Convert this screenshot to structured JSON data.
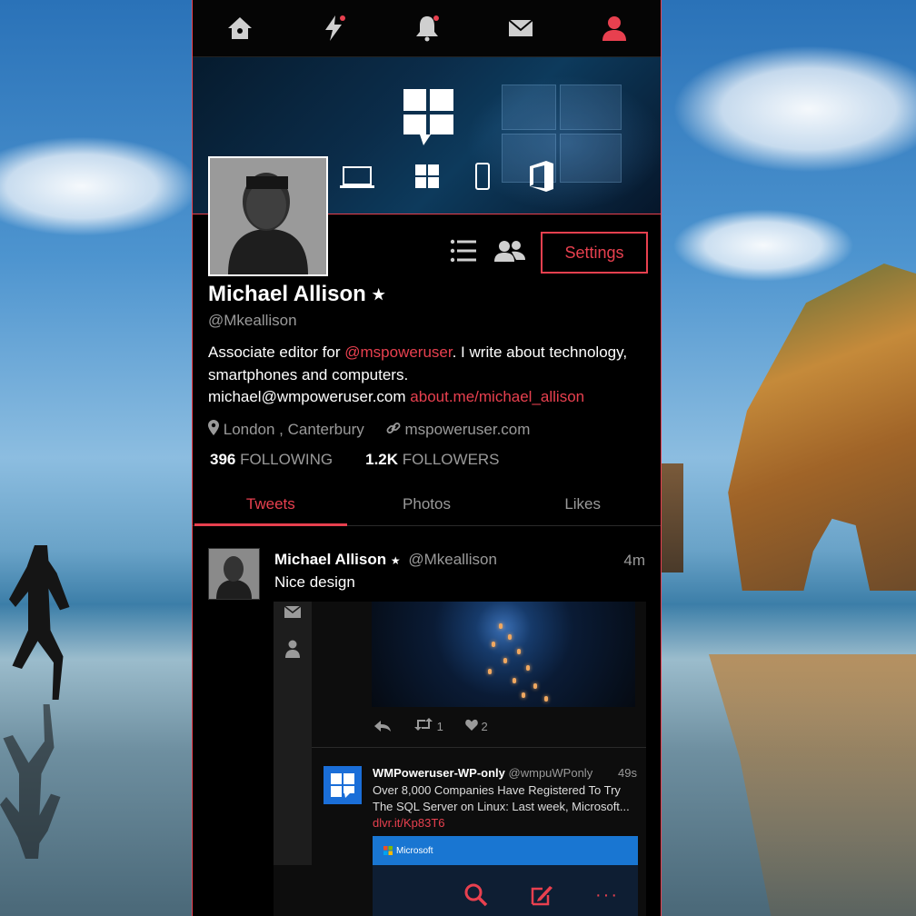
{
  "desktop": {
    "wallpaper": "beach-wallpaper"
  },
  "nav": {
    "items": [
      {
        "icon": "home-icon"
      },
      {
        "icon": "lightning-icon",
        "badge": true
      },
      {
        "icon": "bell-icon",
        "badge": true
      },
      {
        "icon": "mail-icon"
      },
      {
        "icon": "person-icon",
        "active": true
      }
    ]
  },
  "profile": {
    "name": "Michael Allison",
    "verified_icon": "star-icon",
    "handle": "@Mkeallison",
    "settings_label": "Settings",
    "bio_part1": "Associate editor for ",
    "bio_mention": "@mspoweruser",
    "bio_part2": ". I write about technology,  smartphones and computers.",
    "bio_email": "michael@wmpoweruser.com",
    "bio_link": "about.me/michael_allison",
    "location": "London , Canterbury",
    "website": "mspoweruser.com",
    "following_count": "396",
    "following_label": "FOLLOWING",
    "followers_count": "1.2K",
    "followers_label": "FOLLOWERS"
  },
  "tabs": [
    {
      "label": "Tweets",
      "active": true
    },
    {
      "label": "Photos"
    },
    {
      "label": "Likes"
    }
  ],
  "tweet": {
    "author": "Michael Allison",
    "handle": "@Mkeallison",
    "time": "4m",
    "text": "Nice design",
    "embedded": {
      "retweets": "1",
      "likes": "2",
      "inner_author": "WMPoweruser-WP-only",
      "inner_handle": "@wmpuWPonly",
      "inner_time": "49s",
      "inner_text": "Over 8,000 Companies Have Registered To Try The SQL Server on Linux: Last week, Microsoft... ",
      "inner_link": "dlvr.it/Kp83T6",
      "card_brand": "Microsoft"
    }
  },
  "colors": {
    "accent": "#e8404f",
    "background": "#000000",
    "muted": "#9a9a9a"
  }
}
